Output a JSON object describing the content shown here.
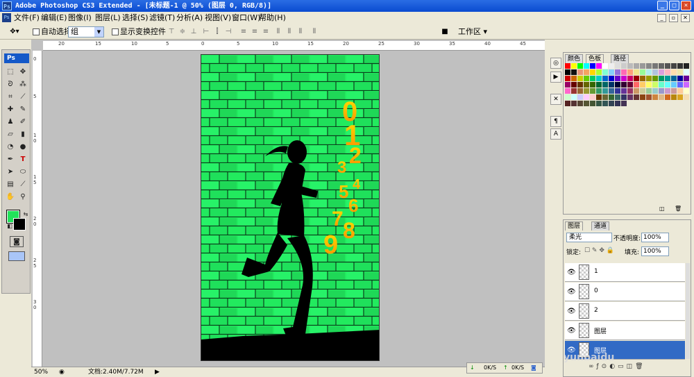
{
  "window": {
    "title": "Adobe Photoshop CS3 Extended - [未标题-1 @ 50% (图层 0, RGB/8)]"
  },
  "menu": [
    "文件(F)",
    "编辑(E)",
    "图像(I)",
    "图层(L)",
    "选择(S)",
    "滤镜(T)",
    "分析(A)",
    "视图(V)",
    "窗口(W)",
    "帮助(H)"
  ],
  "options": {
    "auto_select_label": "自动选择:",
    "auto_select_value": "组",
    "show_transform_label": "显示变换控件",
    "workspace_label": "工作区 ▾"
  },
  "ruler": {
    "top": [
      "20",
      "15",
      "10",
      "5",
      "0",
      "5",
      "10",
      "15",
      "20",
      "25",
      "30",
      "35",
      "40",
      "45"
    ],
    "left": [
      "0",
      "5",
      "1 0",
      "1 5",
      "2 0",
      "2 5",
      "3 0"
    ]
  },
  "artwork": {
    "numbers": [
      "0",
      "1",
      "2",
      "3",
      "4",
      "5",
      "6",
      "7",
      "8",
      "9"
    ]
  },
  "swatch_panel": {
    "tabs": [
      "颜色",
      "色板",
      "路径"
    ]
  },
  "layers_panel": {
    "tabs": [
      "图层",
      "通道"
    ],
    "blend_mode": "柔光",
    "opacity_label": "不透明度:",
    "opacity_value": "100%",
    "lock_label": "锁定:",
    "fill_label": "填充:",
    "fill_value": "100%",
    "layers": [
      {
        "name": "1"
      },
      {
        "name": "0"
      },
      {
        "name": "2"
      },
      {
        "name": "图层"
      },
      {
        "name": "图层"
      }
    ]
  },
  "status": {
    "zoom": "50%",
    "doc_info": "文档:2.40M/7.72M"
  },
  "network": {
    "down": "0K/S",
    "up": "0K/S"
  },
  "watermark": "yunbaidu",
  "colors": {
    "accent": "#316ac5",
    "canvas_green": "#22ea5e",
    "title_blue": "#0a4bd0"
  }
}
